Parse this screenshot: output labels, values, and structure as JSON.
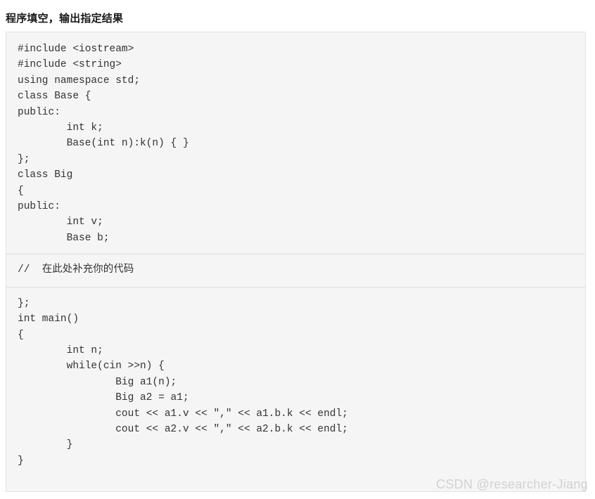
{
  "page": {
    "title": "程序填空，输出指定结果"
  },
  "code": {
    "head": "#include <iostream>\n#include <string>\nusing namespace std;\nclass Base {\npublic:\n        int k;\n        Base(int n):k(n) { }\n};\nclass Big\n{\npublic:\n        int v;\n        Base b;",
    "placeholder_comment": "//  在此处补充你的代码",
    "tail": "};\nint main()\n{\n        int n;\n        while(cin >>n) {\n                Big a1(n);\n                Big a2 = a1;\n                cout << a1.v << \",\" << a1.b.k << endl;\n                cout << a2.v << \",\" << a2.b.k << endl;\n        }\n}"
  },
  "watermark": {
    "text": "CSDN @researcher-Jiang"
  },
  "colors": {
    "code_background": "#f5f5f5",
    "code_border": "#e3e3e3",
    "code_text": "#333333",
    "separator": "#dddddd",
    "title_text": "#1a1a1a",
    "watermark_text": "#d2d2d2"
  }
}
